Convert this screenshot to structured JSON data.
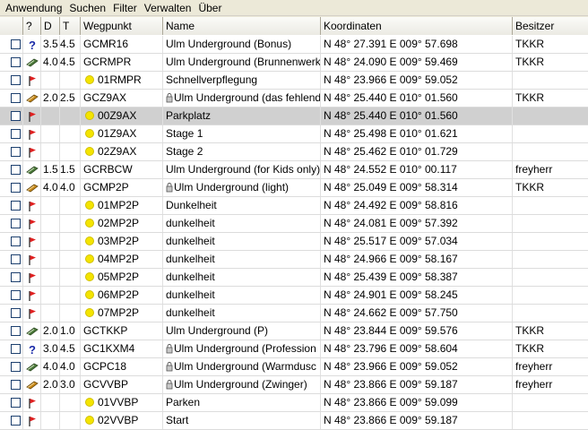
{
  "menu": [
    "Anwendung",
    "Suchen",
    "Filter",
    "Verwalten",
    "Über"
  ],
  "columns": {
    "check": "",
    "type": "?",
    "d": "D",
    "t": "T",
    "waypoint": "Wegpunkt",
    "name": "Name",
    "coords": "Koordinaten",
    "owner": "Besitzer"
  },
  "rows": [
    {
      "icon": "mystery-cache-icon",
      "d": "3.5",
      "t": "4.5",
      "wp": "GCMR16",
      "dot": false,
      "lock": false,
      "name": "Ulm Underground (Bonus)",
      "coords": "N 48° 27.391 E 009° 57.698",
      "owner": "TKKR",
      "selected": false
    },
    {
      "icon": "letterbox-cache-icon",
      "d": "4.0",
      "t": "4.5",
      "wp": "GCRMPR",
      "dot": false,
      "lock": false,
      "name": "Ulm Underground (Brunnenwerk)",
      "coords": "N 48° 24.090 E 009° 59.469",
      "owner": "TKKR",
      "selected": false
    },
    {
      "icon": "flag-icon",
      "d": "",
      "t": "",
      "wp": "01RMPR",
      "dot": true,
      "lock": false,
      "name": "Schnellverpflegung",
      "coords": "N 48° 23.966 E 009° 59.052",
      "owner": "",
      "selected": false
    },
    {
      "icon": "multi-cache-icon",
      "d": "2.0",
      "t": "2.5",
      "wp": "GCZ9AX",
      "dot": false,
      "lock": true,
      "name": "Ulm Underground (das fehlende)",
      "coords": "N 48° 25.440 E 010° 01.560",
      "owner": "TKKR",
      "selected": false
    },
    {
      "icon": "flag-icon",
      "d": "",
      "t": "",
      "wp": "00Z9AX",
      "dot": true,
      "lock": false,
      "name": "Parkplatz",
      "coords": "N 48° 25.440 E 010° 01.560",
      "owner": "",
      "selected": true
    },
    {
      "icon": "flag-icon",
      "d": "",
      "t": "",
      "wp": "01Z9AX",
      "dot": true,
      "lock": false,
      "name": "Stage 1",
      "coords": "N 48° 25.498 E 010° 01.621",
      "owner": "",
      "selected": false
    },
    {
      "icon": "flag-icon",
      "d": "",
      "t": "",
      "wp": "02Z9AX",
      "dot": true,
      "lock": false,
      "name": "Stage 2",
      "coords": "N 48° 25.462 E 010° 01.729",
      "owner": "",
      "selected": false
    },
    {
      "icon": "letterbox-cache-icon",
      "d": "1.5",
      "t": "1.5",
      "wp": "GCRBCW",
      "dot": false,
      "lock": false,
      "name": "Ulm Underground (for Kids only)",
      "coords": "N 48° 24.552 E 010° 00.117",
      "owner": "freyherr",
      "selected": false
    },
    {
      "icon": "multi-cache-icon",
      "d": "4.0",
      "t": "4.0",
      "wp": "GCMP2P",
      "dot": false,
      "lock": true,
      "name": "Ulm Underground (light)",
      "coords": "N 48° 25.049 E 009° 58.314",
      "owner": "TKKR",
      "selected": false
    },
    {
      "icon": "flag-icon",
      "d": "",
      "t": "",
      "wp": "01MP2P",
      "dot": true,
      "lock": false,
      "name": "Dunkelheit",
      "coords": "N 48° 24.492 E 009° 58.816",
      "owner": "",
      "selected": false
    },
    {
      "icon": "flag-icon",
      "d": "",
      "t": "",
      "wp": "02MP2P",
      "dot": true,
      "lock": false,
      "name": "dunkelheit",
      "coords": "N 48° 24.081 E 009° 57.392",
      "owner": "",
      "selected": false
    },
    {
      "icon": "flag-icon",
      "d": "",
      "t": "",
      "wp": "03MP2P",
      "dot": true,
      "lock": false,
      "name": "dunkelheit",
      "coords": "N 48° 25.517 E 009° 57.034",
      "owner": "",
      "selected": false
    },
    {
      "icon": "flag-icon",
      "d": "",
      "t": "",
      "wp": "04MP2P",
      "dot": true,
      "lock": false,
      "name": "dunkelheit",
      "coords": "N 48° 24.966 E 009° 58.167",
      "owner": "",
      "selected": false
    },
    {
      "icon": "flag-icon",
      "d": "",
      "t": "",
      "wp": "05MP2P",
      "dot": true,
      "lock": false,
      "name": "dunkelheit",
      "coords": "N 48° 25.439 E 009° 58.387",
      "owner": "",
      "selected": false
    },
    {
      "icon": "flag-icon",
      "d": "",
      "t": "",
      "wp": "06MP2P",
      "dot": true,
      "lock": false,
      "name": "dunkelheit",
      "coords": "N 48° 24.901 E 009° 58.245",
      "owner": "",
      "selected": false
    },
    {
      "icon": "flag-icon",
      "d": "",
      "t": "",
      "wp": "07MP2P",
      "dot": true,
      "lock": false,
      "name": "dunkelheit",
      "coords": "N 48° 24.662 E 009° 57.750",
      "owner": "",
      "selected": false
    },
    {
      "icon": "letterbox-cache-icon",
      "d": "2.0",
      "t": "1.0",
      "wp": "GCTKKP",
      "dot": false,
      "lock": false,
      "name": "Ulm Underground (P)",
      "coords": "N 48° 23.844 E 009° 59.576",
      "owner": "TKKR",
      "selected": false
    },
    {
      "icon": "mystery-cache-icon",
      "d": "3.0",
      "t": "4.5",
      "wp": "GC1KXM4",
      "dot": false,
      "lock": true,
      "name": "Ulm Underground (Profession",
      "coords": "N 48° 23.796 E 009° 58.604",
      "owner": "TKKR",
      "selected": false
    },
    {
      "icon": "letterbox-cache-icon",
      "d": "4.0",
      "t": "4.0",
      "wp": "GCPC18",
      "dot": false,
      "lock": true,
      "name": "Ulm Underground (Warmdusc",
      "coords": "N 48° 23.966 E 009° 59.052",
      "owner": "freyherr",
      "selected": false
    },
    {
      "icon": "multi-cache-icon",
      "d": "2.0",
      "t": "3.0",
      "wp": "GCVVBP",
      "dot": false,
      "lock": true,
      "name": "Ulm Underground (Zwinger)",
      "coords": "N 48° 23.866 E 009° 59.187",
      "owner": "freyherr",
      "selected": false
    },
    {
      "icon": "flag-icon",
      "d": "",
      "t": "",
      "wp": "01VVBP",
      "dot": true,
      "lock": false,
      "name": "Parken",
      "coords": "N 48° 23.866 E 009° 59.099",
      "owner": "",
      "selected": false
    },
    {
      "icon": "flag-icon",
      "d": "",
      "t": "",
      "wp": "02VVBP",
      "dot": true,
      "lock": false,
      "name": "Start",
      "coords": "N 48° 23.866 E 009° 59.187",
      "owner": "",
      "selected": false
    }
  ],
  "colors": {
    "selected_row": "#d0d0d0",
    "waypoint_dot": "#f4e400",
    "flag_red": "#e02020",
    "mystery_blue": "#1a2aa8"
  }
}
